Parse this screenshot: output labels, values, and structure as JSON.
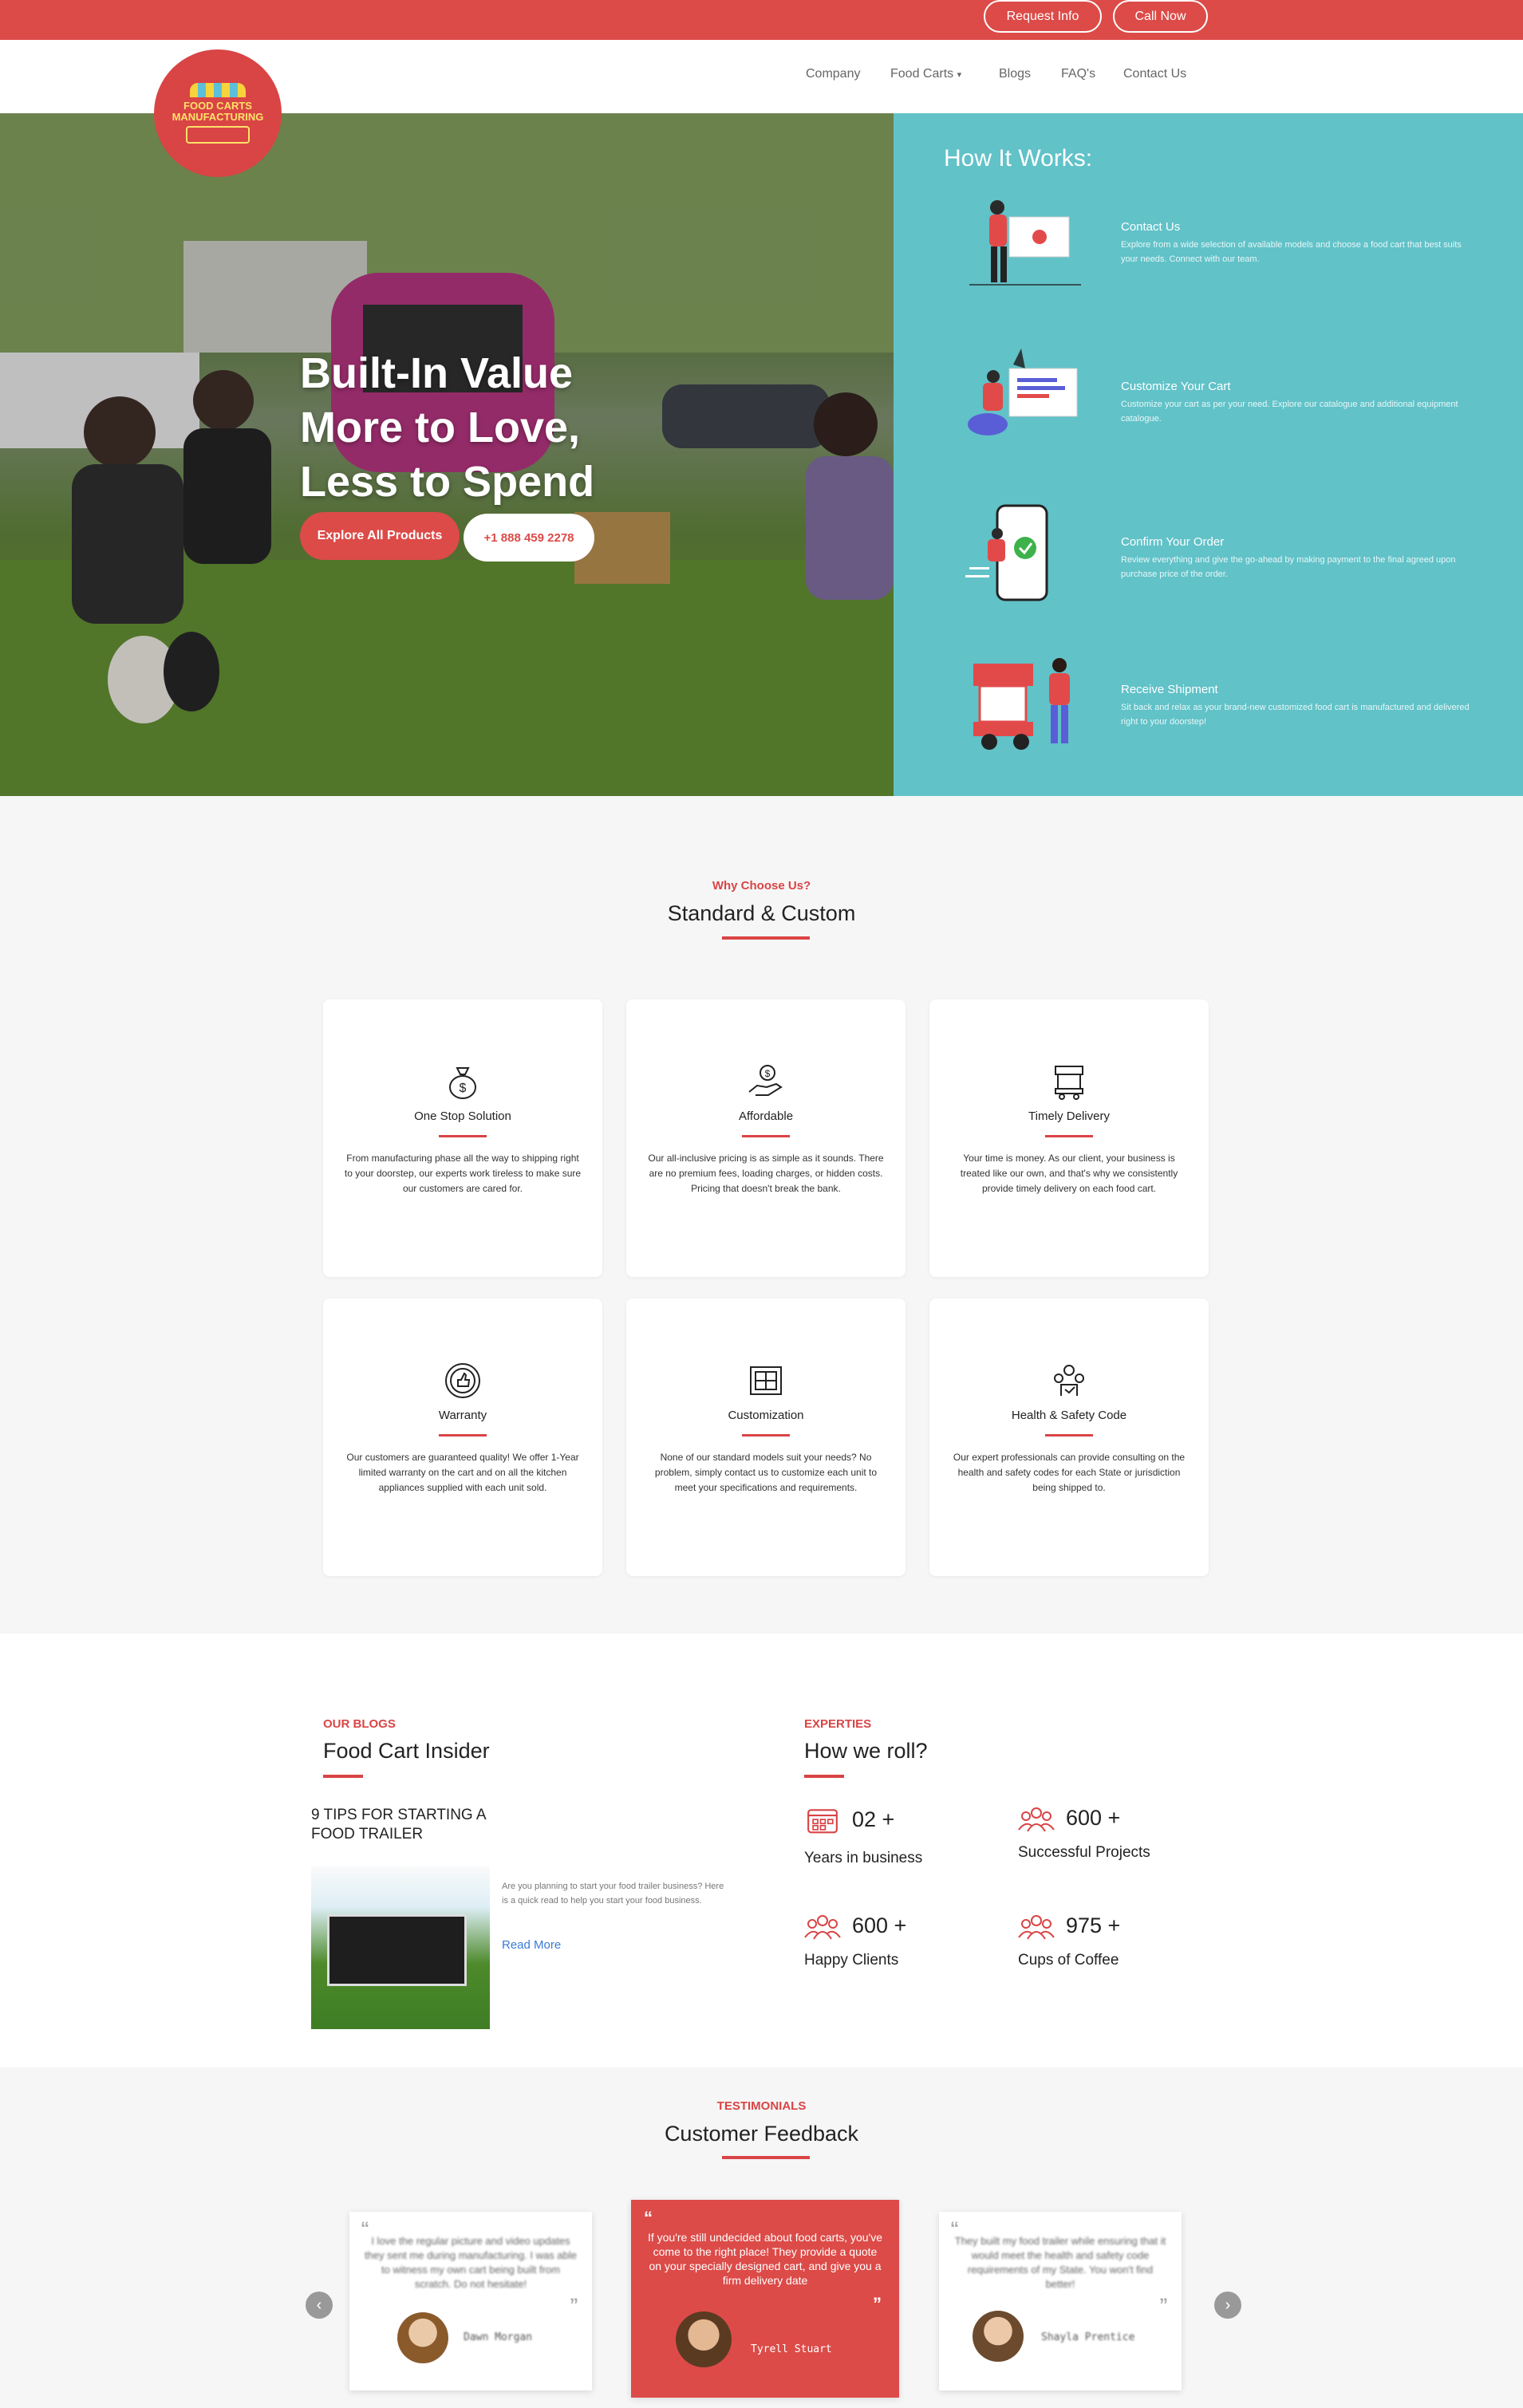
{
  "topbar": {
    "request_info": "Request Info",
    "call_now": "Call Now"
  },
  "logo": {
    "text": "FOOD CARTS MANUFACTURING"
  },
  "nav": {
    "items": [
      "Company",
      "Food Carts",
      "Blogs",
      "FAQ's",
      "Contact Us"
    ],
    "dropdown_caret": "▾"
  },
  "hero": {
    "title_line1": "Built-In Value",
    "title_line2": "More to Love,",
    "title_line3": "Less to Spend",
    "explore_button": "Explore All Products",
    "phone_button": "+1 888 459 2278"
  },
  "how_it_works": {
    "title": "How It Works:",
    "steps": [
      {
        "title": "Contact Us",
        "desc": "Explore from a wide selection of available models and choose a food cart that best suits your needs. Connect with our team."
      },
      {
        "title": "Customize Your Cart",
        "desc": "Customize your cart as per your need. Explore our catalogue and additional equipment catalogue."
      },
      {
        "title": "Confirm Your Order",
        "desc": "Review everything and give the go-ahead by making payment to the final agreed upon purchase price of the order."
      },
      {
        "title": "Receive Shipment",
        "desc": "Sit back and relax as your brand-new customized food cart is manufactured and delivered right to your doorstep!"
      }
    ]
  },
  "why": {
    "eyebrow": "Why Choose Us?",
    "title": "Standard & Custom",
    "cards": [
      {
        "icon": "money-bag-icon",
        "title": "One Stop Solution",
        "desc": "From manufacturing phase all the way to shipping right to your doorstep, our experts work tireless to make sure our customers are cared for."
      },
      {
        "icon": "hand-dollar-icon",
        "title": "Affordable",
        "desc": "Our all-inclusive pricing is as simple as it sounds. There are no premium fees, loading charges, or hidden costs. Pricing that doesn't break the bank."
      },
      {
        "icon": "food-cart-icon",
        "title": "Timely Delivery",
        "desc": "Your time is money. As our client, your business is treated like our own, and that's why we consistently provide timely delivery on each food cart."
      },
      {
        "icon": "thumbs-up-badge-icon",
        "title": "Warranty",
        "desc": "Our customers are guaranteed quality! We offer 1-Year limited warranty on the cart and on all the kitchen appliances supplied with each unit sold."
      },
      {
        "icon": "blueprint-icon",
        "title": "Customization",
        "desc": "None of our standard models suit your needs? No problem, simply contact us to customize each unit to meet your specifications and requirements."
      },
      {
        "icon": "safety-team-icon",
        "title": "Health & Safety Code",
        "desc": "Our expert professionals can provide consulting on the health and safety codes for each State or jurisdiction being shipped to."
      }
    ]
  },
  "blogs": {
    "eyebrow": "OUR BLOGS",
    "title": "Food Cart Insider",
    "post_title_line1": "9 TIPS FOR STARTING A",
    "post_title_line2": "FOOD TRAILER",
    "post_excerpt": "Are you planning to start your food trailer business? Here is a quick read to help you start your food business.",
    "read_more": "Read More"
  },
  "experties": {
    "eyebrow": "EXPERTIES",
    "title": "How we roll?",
    "stats": [
      {
        "icon": "calendar-icon",
        "value": "02 +",
        "label": "Years in business"
      },
      {
        "icon": "people-icon",
        "value": "600 +",
        "label": "Successful Projects"
      },
      {
        "icon": "people-icon",
        "value": "600 +",
        "label": "Happy Clients"
      },
      {
        "icon": "people-icon",
        "value": "975 +",
        "label": "Cups of Coffee"
      }
    ]
  },
  "testimonials": {
    "eyebrow": "TESTIMONIALS",
    "title": "Customer Feedback",
    "items": [
      {
        "quote": "I love the regular picture and video updates they sent me during manufacturing. I was able to witness my own cart being built from scratch. Do not hesitate!",
        "name": "Dawn Morgan"
      },
      {
        "quote": "If you're still undecided about food carts, you've come to the right place! They provide a quote on your specially designed cart, and give you a firm delivery date",
        "name": "Tyrell Stuart"
      },
      {
        "quote": "They built my food trailer while ensuring that it would meet the health and safety code requirements of my State. You won't find better!",
        "name": "Shayla Prentice"
      }
    ],
    "prev": "‹",
    "next": "›"
  },
  "colors": {
    "brand_red": "#dc4b48",
    "teal": "#61c2c8"
  }
}
